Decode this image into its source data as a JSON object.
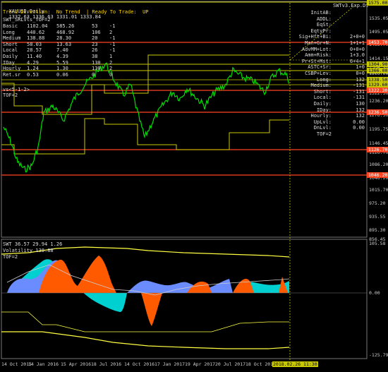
{
  "header": {
    "title": "XAUUSD,Daily",
    "ohlc": "1332.63 1336.63 1331.01 1333.84",
    "swt_label": "SWTv3.Exp.Dt"
  },
  "info": {
    "trend_line": "Trend Direction:  No Trend  | Ready To Trade:  UP",
    "levels_title": "SWT_SRLvls_TOF=2",
    "rows": [
      {
        "name": "Basic",
        "a": "1102.04",
        "b": "585.26",
        "c": "53",
        "d": "-1"
      },
      {
        "name": "Long",
        "a": "440.62",
        "b": "468.92",
        "c": "106",
        "d": "2"
      },
      {
        "name": "Medium",
        "a": "138.88",
        "b": "28.30",
        "c": "20",
        "d": "-1"
      },
      {
        "name": "Short",
        "a": "58.03",
        "b": "13.63",
        "c": "23",
        "d": "-1"
      },
      {
        "name": "Local",
        "a": "28.57",
        "b": "7.40",
        "c": "26",
        "d": "-1"
      },
      {
        "name": "Daily",
        "a": "11.40",
        "b": "4.39",
        "c": "38",
        "d": "1"
      },
      {
        "name": "IDay",
        "a": "4.29",
        "b": "5.59",
        "c": "130",
        "d": "2"
      },
      {
        "name": "Hourly",
        "a": "1.24",
        "b": "1.30",
        "c": "130",
        "d": "2"
      },
      {
        "name": "Ret.sr",
        "a": "0.53",
        "b": "0.06",
        "c": "0",
        "d": "0"
      }
    ],
    "vs_line": "vs<5-1-2>",
    "tof_line": "TOF=2"
  },
  "right_panel": [
    {
      "label": "InitAB:",
      "value": ""
    },
    {
      "label": "ADDL:",
      "value": ""
    },
    {
      "label": "EqSt:",
      "value": ""
    },
    {
      "label": "EqtyPr:",
      "value": ""
    },
    {
      "label": "Sig+Hft+Bi:",
      "value": "2+0+0"
    },
    {
      "label": "Man+Gr+N:",
      "value": "1+1+1"
    },
    {
      "label": "AdvMM+Lot:",
      "value": "0+0+0"
    },
    {
      "label": "Amm+Risk:",
      "value": "1+3.0"
    },
    {
      "label": "Pr+St+Mst:",
      "value": "6+4+1"
    },
    {
      "label": "ASTC+Sr:",
      "value": "1+0"
    },
    {
      "label": "CSBP+Lev:",
      "value": "0+0"
    },
    {
      "label": "Long:",
      "value": "132"
    },
    {
      "label": "Medium:",
      "value": "-131"
    },
    {
      "label": "Short:",
      "value": "-131"
    },
    {
      "label": "Local:",
      "value": "-131"
    },
    {
      "label": "Daily:",
      "value": "130"
    },
    {
      "label": "IDay:",
      "value": "132"
    },
    {
      "label": "Hourly:",
      "value": "132"
    },
    {
      "label": "UpLvl:",
      "value": "0.00"
    },
    {
      "label": "DnLvl:",
      "value": "0.00"
    },
    {
      "label": "TOF=2",
      "value": ""
    }
  ],
  "price_axis": [
    "1575.00",
    "1535.05",
    "1495.05",
    "1453.70",
    "1414.15",
    "1374.75",
    "1304.90",
    "1366.00",
    "1338.50",
    "1329.60",
    "1322.30",
    "1276.50",
    "1236.20",
    "1195.75",
    "1146.45",
    "1126.70",
    "1086.20",
    "1046.20",
    "1015.70",
    "975.20",
    "935.55",
    "895.30",
    "856.45"
  ],
  "price_tags": [
    {
      "text": "1575.00",
      "color": "#c8c800"
    },
    {
      "text": "1453.70",
      "color": "#ff4422"
    },
    {
      "text": "1304.90",
      "color": "#c8c800"
    },
    {
      "text": "1366.00",
      "color": "#c8c800"
    },
    {
      "text": "1338.50",
      "color": "#c8c800"
    },
    {
      "text": "1329.60",
      "color": "#c8c800"
    },
    {
      "text": "1322.30",
      "color": "#ff4422"
    },
    {
      "text": "1236.50",
      "color": "#ff4422"
    },
    {
      "text": "1126.70",
      "color": "#ff4422"
    },
    {
      "text": "1046.20",
      "color": "#ff4422"
    }
  ],
  "subwindow": {
    "title": "SWT 36.57 29.94 1.26",
    "volatility": "Volatility 138.88",
    "tof": "TOF=2",
    "axis": [
      "105.58",
      "0.00",
      "-125.79"
    ]
  },
  "time_axis": [
    "14 Oct 2015",
    "14 Jan 2016",
    "15 Apr 2016",
    "18 Jul 2016",
    "14 Oct 2016",
    "17 Jan 2017",
    "19 Apr 2017",
    "20 Jul 2017",
    "18 Oct 2017"
  ],
  "time_cursor": "2018.02.26 11:30",
  "colors": {
    "candle": "#00dd00",
    "yellow": "#c8c800",
    "red_line": "#ff4422",
    "cyan": "#00d0d0",
    "orange": "#ff5a00",
    "blue": "#6a8cff",
    "green_label": "#00ff00"
  }
}
